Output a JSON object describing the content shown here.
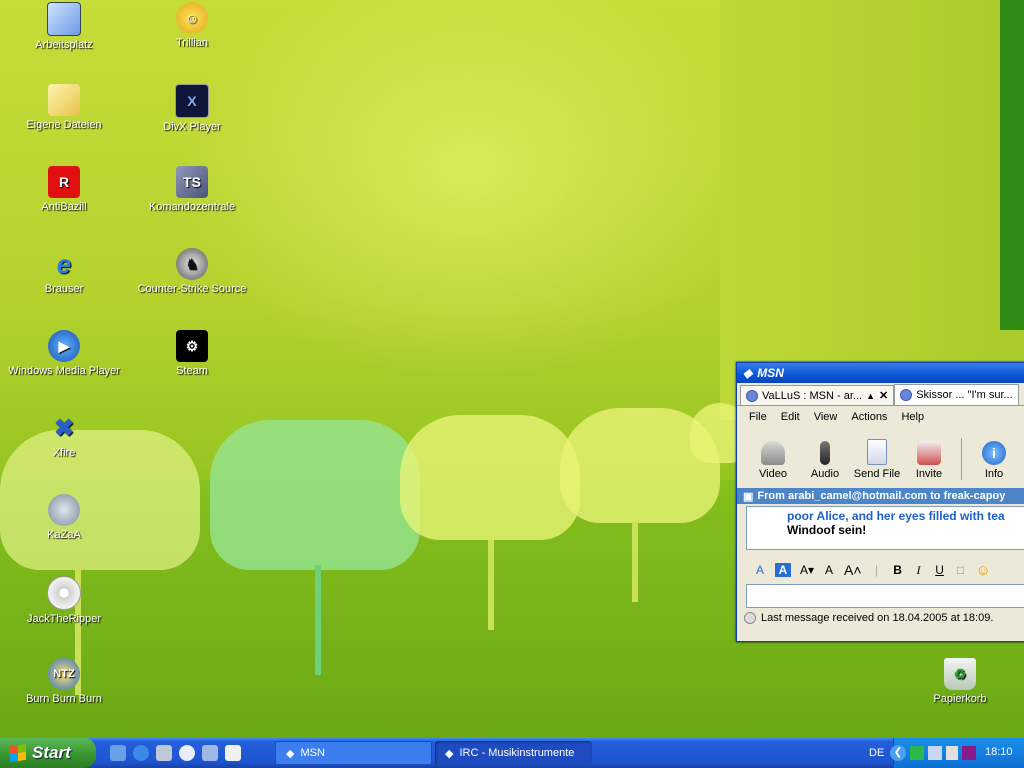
{
  "desktop": {
    "icons": [
      {
        "label": "Arbeitsplatz",
        "icon": "my-computer-icon"
      },
      {
        "label": "Eigene Dateien",
        "icon": "my-documents-icon"
      },
      {
        "label": "AntiBazill",
        "icon": "antivirus-icon"
      },
      {
        "label": "Brauser",
        "icon": "internet-explorer-icon"
      },
      {
        "label": "Windows Media Player",
        "icon": "media-player-icon"
      },
      {
        "label": "Xfire",
        "icon": "xfire-icon"
      },
      {
        "label": "KaZaA",
        "icon": "kazaa-icon"
      },
      {
        "label": "JackTheRipper",
        "icon": "cd-ripper-icon"
      },
      {
        "label": "Burn Burn Burn",
        "icon": "nero-burn-icon"
      },
      {
        "label": "Trillian",
        "icon": "trillian-icon"
      },
      {
        "label": "DivX Player",
        "icon": "divx-icon"
      },
      {
        "label": "Komandozentrale",
        "icon": "teamspeak-icon"
      },
      {
        "label": "Counter-Strike Source",
        "icon": "counter-strike-icon"
      },
      {
        "label": "Steam",
        "icon": "steam-icon"
      },
      {
        "label": "Papierkorb",
        "icon": "recycle-bin-icon"
      }
    ]
  },
  "msn": {
    "title": "MSN",
    "tabs": [
      {
        "label": "VaLLuS  : MSN - ar..."
      },
      {
        "label": "Skissor ... \"I'm sur..."
      }
    ],
    "menu": [
      "File",
      "Edit",
      "View",
      "Actions",
      "Help"
    ],
    "toolbar": [
      "Video",
      "Audio",
      "Send File",
      "Invite",
      "Info"
    ],
    "from_line": "From arabi_camel@hotmail.com to freak-capoy",
    "chat_line1": "poor Alice, and her eyes filled with tea",
    "chat_line2": "Windoof sein!",
    "format_buttons": [
      "A",
      "A",
      "A▾",
      "A",
      "A˄",
      "B",
      "I",
      "U"
    ],
    "status": "Last message received on 18.04.2005 at 18:09."
  },
  "taskbar": {
    "start_label": "Start",
    "tasks": [
      {
        "label": "MSN"
      },
      {
        "label": "IRC - Musikinstrumente"
      }
    ],
    "language": "DE",
    "clock": "18:10"
  },
  "colors": {
    "taskbar_blue": "#245edb",
    "start_green": "#3c9a32",
    "msn_title_blue": "#0a55d6",
    "chat_blue_text": "#1d5fc8"
  }
}
